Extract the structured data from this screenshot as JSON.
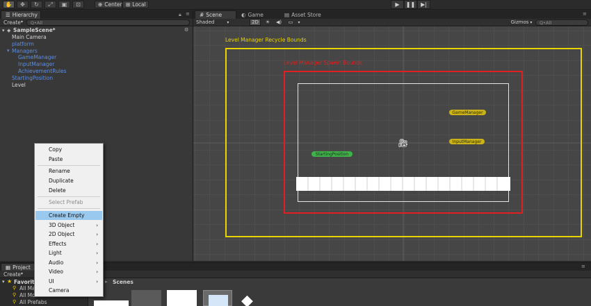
{
  "toolbar": {
    "tools": [
      "hand-tool",
      "move-tool",
      "rotate-tool",
      "scale-tool",
      "rect-tool",
      "transform-tool"
    ],
    "pivot_label": "Center",
    "space_label": "Local"
  },
  "hierarchy": {
    "tab_label": "Hierarchy",
    "create_label": "Create",
    "search_placeholder": "Q•All",
    "scene_name": "SampleScene*",
    "items": [
      {
        "label": "Main Camera",
        "style": "light",
        "indent": 0
      },
      {
        "label": "platform",
        "style": "blue",
        "indent": 0
      },
      {
        "label": "Managers",
        "style": "blue",
        "indent": 0,
        "expanded": true
      },
      {
        "label": "GameManager",
        "style": "blue",
        "indent": 1
      },
      {
        "label": "InputManager",
        "style": "blue",
        "indent": 1
      },
      {
        "label": "AchievementRules",
        "style": "blue",
        "indent": 1
      },
      {
        "label": "StartingPosition",
        "style": "blue",
        "indent": 0
      },
      {
        "label": "Level",
        "style": "light",
        "indent": 0
      }
    ]
  },
  "scene_tabs": [
    {
      "label": "Scene",
      "icon": "grid-icon",
      "active": true
    },
    {
      "label": "Game",
      "icon": "game-icon",
      "active": false
    },
    {
      "label": "Asset Store",
      "icon": "store-icon",
      "active": false
    }
  ],
  "scene_toolbar": {
    "shading_mode": "Shaded",
    "mode_2d": "2D",
    "gizmos_label": "Gizmos",
    "search_placeholder": "Q•All"
  },
  "scene": {
    "yellow_label": "Level Manager Recycle Bounds",
    "red_label": "Level Manager Spawn Bounds",
    "game_manager_label": "GameManager",
    "input_manager_label": "InputManager",
    "starting_position_label": "StartingPosition",
    "colors": {
      "yellow": "#e8d400",
      "red": "#e02020",
      "pill_yellow": "#c9b21a",
      "pill_green": "#3fb24a"
    }
  },
  "project": {
    "tab_label": "Project",
    "create_label": "Create",
    "breadcrumb": "Scenes",
    "favorites_label": "Favorites",
    "items": [
      "All Materials",
      "All Models",
      "All Prefabs"
    ]
  },
  "context_menu": {
    "items": [
      {
        "label": "Copy"
      },
      {
        "label": "Paste"
      },
      {
        "separator": true
      },
      {
        "label": "Rename"
      },
      {
        "label": "Duplicate"
      },
      {
        "label": "Delete"
      },
      {
        "separator": true
      },
      {
        "label": "Select Prefab",
        "disabled": true
      },
      {
        "separator": true
      },
      {
        "label": "Create Empty",
        "highlighted": true
      },
      {
        "label": "3D Object",
        "submenu": true
      },
      {
        "label": "2D Object",
        "submenu": true
      },
      {
        "label": "Effects",
        "submenu": true
      },
      {
        "label": "Light",
        "submenu": true
      },
      {
        "label": "Audio",
        "submenu": true
      },
      {
        "label": "Video",
        "submenu": true
      },
      {
        "label": "UI",
        "submenu": true
      },
      {
        "label": "Camera"
      }
    ]
  }
}
